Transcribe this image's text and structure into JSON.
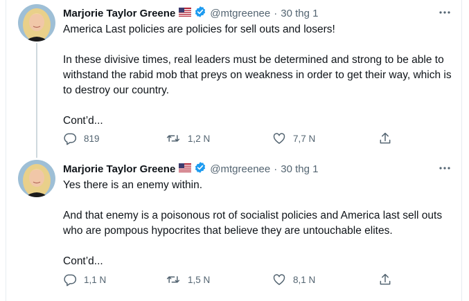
{
  "tweets": [
    {
      "display_name": "Marjorie Taylor Greene",
      "handle": "@mtgreenee",
      "separator": "·",
      "date": "30 thg 1",
      "paragraphs": [
        "America Last policies are policies for sell outs and losers!",
        "In these divisive times, real leaders must be determined and strong to be able to withstand the rabid mob that preys on weakness in order to get their way, which is to destroy our country.",
        "Cont’d..."
      ],
      "reply_count": "819",
      "retweet_count": "1,2 N",
      "like_count": "7,7 N"
    },
    {
      "display_name": "Marjorie Taylor Greene",
      "handle": "@mtgreenee",
      "separator": "·",
      "date": "30 thg 1",
      "paragraphs": [
        "Yes there is an enemy within.",
        "And that enemy is a poisonous rot of socialist policies and America last sell outs who are pompous hypocrites that believe they are untouchable elites.",
        "Cont’d..."
      ],
      "reply_count": "1,1 N",
      "retweet_count": "1,5 N",
      "like_count": "8,1 N"
    }
  ],
  "icons": {
    "reply": "reply-icon",
    "retweet": "retweet-icon",
    "like": "heart-icon",
    "share": "share-icon",
    "more": "more-icon",
    "verified": "verified-badge-icon",
    "flag": "us-flag-icon"
  },
  "colors": {
    "accent": "#1d9bf0",
    "secondary_text": "#536471",
    "thread_line": "#cfd9de"
  }
}
